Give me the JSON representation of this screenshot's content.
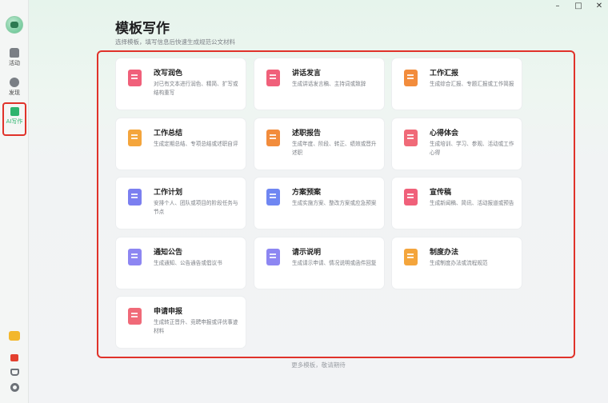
{
  "window": {
    "minimize": "–",
    "maximize": "□",
    "close": "✕"
  },
  "sidebar": {
    "items": [
      {
        "label": "活动",
        "icon": "home-icon"
      },
      {
        "label": "发现",
        "icon": "compass-icon"
      },
      {
        "label": "AI写作",
        "icon": "ai-write-icon",
        "active": true
      }
    ],
    "bottom": [
      "robot-icon",
      "gift-icon",
      "basket-icon",
      "settings-icon"
    ]
  },
  "header": {
    "title": "模板写作",
    "subtitle": "选择模板，填写信息后快速生成规范公文材料"
  },
  "templates": [
    {
      "title": "改写润色",
      "desc": "对已有文本进行润色、精简、扩写或结构重写",
      "color": "#f0607a"
    },
    {
      "title": "讲话发言",
      "desc": "生成讲话发言稿、主持词或致辞",
      "color": "#f0607a"
    },
    {
      "title": "工作汇报",
      "desc": "生成综合汇报、专题汇报或工作简报",
      "color": "#f28c3c"
    },
    {
      "title": "工作总结",
      "desc": "生成定期总结、专项总结或述职自评",
      "color": "#f4a53c"
    },
    {
      "title": "述职报告",
      "desc": "生成年度、阶段、转正、绩效或晋升述职",
      "color": "#f28c3c"
    },
    {
      "title": "心得体会",
      "desc": "生成培训、学习、参观、活动或工作心得",
      "color": "#f06a78"
    },
    {
      "title": "工作计划",
      "desc": "安排个人、团队或项目的阶段任务与节点",
      "color": "#7b7ff0"
    },
    {
      "title": "方案预案",
      "desc": "生成实施方案、整改方案或应急预案",
      "color": "#6f86f2"
    },
    {
      "title": "宣传稿",
      "desc": "生成新闻稿、简讯、活动报道或预告",
      "color": "#f0607a"
    },
    {
      "title": "通知公告",
      "desc": "生成通知、公告通告或倡议书",
      "color": "#8d86f2"
    },
    {
      "title": "请示说明",
      "desc": "生成请示申请、情况说明或函件回复",
      "color": "#8d86f2"
    },
    {
      "title": "制度办法",
      "desc": "生成制度办法或流程规范",
      "color": "#f4a53c"
    },
    {
      "title": "申请申报",
      "desc": "生成转正晋升、竞聘申报或评优事迹材料",
      "color": "#f06a78"
    }
  ],
  "footer": "更多模板，敬请期待"
}
